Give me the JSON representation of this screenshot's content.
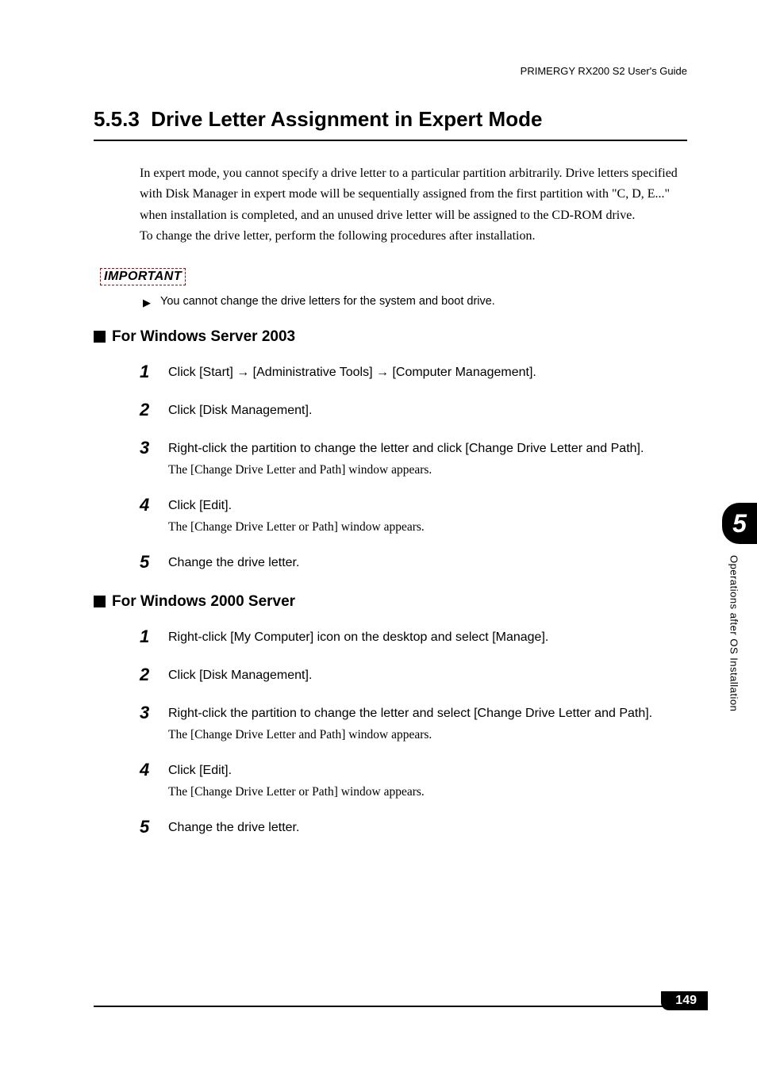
{
  "header": {
    "doc_title": "PRIMERGY RX200 S2 User's Guide"
  },
  "section": {
    "number": "5.5.3",
    "title": "Drive Letter Assignment in Expert Mode"
  },
  "intro": {
    "p1": "In expert mode, you cannot specify a drive letter to a particular partition arbitrarily. Drive letters specified with Disk Manager in expert mode will be sequentially assigned from the first partition with \"C, D, E...\" when installation is completed, and an unused drive letter will be assigned to the CD-ROM drive.",
    "p2": "To change the drive letter, perform the following procedures after installation."
  },
  "important": {
    "label": "IMPORTANT",
    "bullet": "You cannot change the drive letters for the system and boot drive."
  },
  "subsections": [
    {
      "title": "For Windows Server 2003",
      "steps": [
        {
          "num": "1",
          "action": "Click [Start] → [Administrative Tools] → [Computer Management].",
          "note": ""
        },
        {
          "num": "2",
          "action": "Click [Disk Management].",
          "note": ""
        },
        {
          "num": "3",
          "action": "Right-click the partition to change the letter and click [Change Drive Letter and Path].",
          "note": "The [Change Drive Letter and Path] window appears."
        },
        {
          "num": "4",
          "action": "Click [Edit].",
          "note": "The [Change Drive Letter or Path] window appears."
        },
        {
          "num": "5",
          "action": "Change the drive letter.",
          "note": ""
        }
      ]
    },
    {
      "title": "For Windows 2000 Server",
      "steps": [
        {
          "num": "1",
          "action": "Right-click [My Computer] icon on the desktop and select [Manage].",
          "note": ""
        },
        {
          "num": "2",
          "action": "Click [Disk Management].",
          "note": ""
        },
        {
          "num": "3",
          "action": "Right-click the partition to change the letter and select [Change Drive Letter and Path].",
          "note": "The [Change Drive Letter and Path] window appears."
        },
        {
          "num": "4",
          "action": "Click [Edit].",
          "note": "The [Change Drive Letter or Path] window appears."
        },
        {
          "num": "5",
          "action": "Change the drive letter.",
          "note": ""
        }
      ]
    }
  ],
  "sidetab": {
    "chapter_num": "5",
    "chapter_label": "Operations after OS Installation"
  },
  "footer": {
    "page_num": "149"
  }
}
